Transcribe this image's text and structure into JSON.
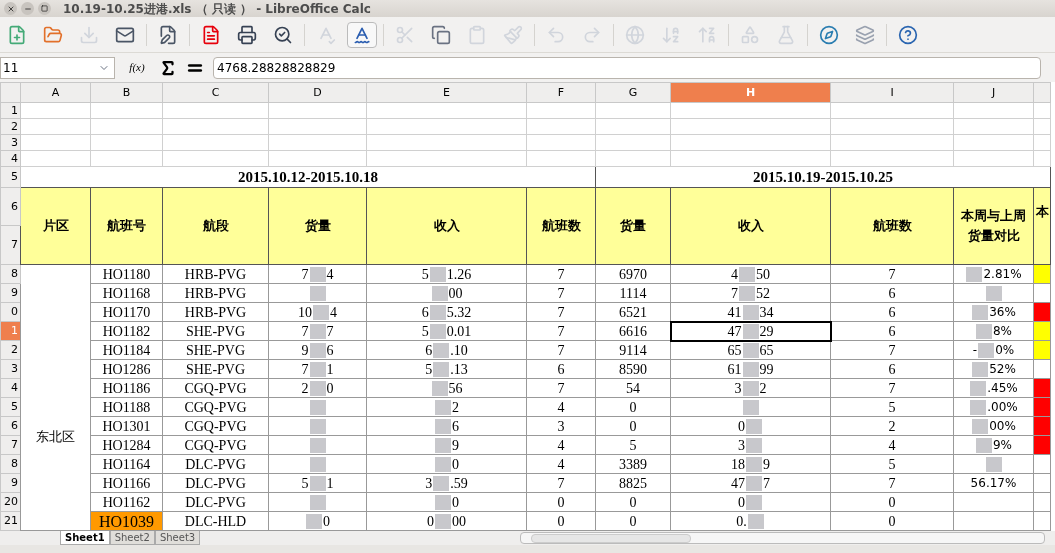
{
  "window": {
    "title": "10.19-10.25进港.xls （ 只读 ） - LibreOffice Calc"
  },
  "formula_bar": {
    "cell_ref": "11",
    "function_label": "f(x)",
    "value": "4768.28828828829"
  },
  "columns": [
    {
      "label": "A",
      "selected": false
    },
    {
      "label": "B",
      "selected": false
    },
    {
      "label": "C",
      "selected": false
    },
    {
      "label": "D",
      "selected": false
    },
    {
      "label": "E",
      "selected": false
    },
    {
      "label": "F",
      "selected": false
    },
    {
      "label": "G",
      "selected": false
    },
    {
      "label": "H",
      "selected": true
    },
    {
      "label": "I",
      "selected": false
    },
    {
      "label": "J",
      "selected": false
    }
  ],
  "blank_rows": [
    "1",
    "2",
    "3",
    "4"
  ],
  "period_row": {
    "num": "5",
    "last_week": "2015.10.12-2015.10.18",
    "this_week": "2015.10.19-2015.10.25"
  },
  "header_rows": [
    "6",
    "7"
  ],
  "headers": [
    "片区",
    "航班号",
    "航段",
    "货量",
    "收入",
    "航班数",
    "货量",
    "收入",
    "航班数",
    "本周与上周货量对比",
    "本"
  ],
  "region": "东北区",
  "rows": [
    {
      "num": "8",
      "selected": false,
      "flight": "HO1180",
      "highlight": false,
      "route": "HRB-PVG",
      "cargo_prev": {
        "smear": true,
        "before": "7",
        "after": "4"
      },
      "revenue_prev": {
        "smear": true,
        "before": "5",
        "after": "1.26"
      },
      "flights_prev": "7",
      "cargo": "6970",
      "revenue": {
        "smear": true,
        "before": "4",
        "after": "50"
      },
      "flights": "7",
      "compare": {
        "smear": true,
        "after": "2.81%"
      },
      "color": "#ffff00"
    },
    {
      "num": "9",
      "selected": false,
      "flight": "HO1168",
      "highlight": false,
      "route": "HRB-PVG",
      "cargo_prev": {
        "smear": true
      },
      "revenue_prev": {
        "smear": true,
        "after": "00"
      },
      "flights_prev": "7",
      "cargo": "1114",
      "revenue": {
        "smear": true,
        "before": "7",
        "after": "52"
      },
      "flights": "6",
      "compare": {
        "smear": true
      },
      "color": "#ffffff"
    },
    {
      "num": "0",
      "selected": false,
      "flight": "HO1170",
      "highlight": false,
      "route": "HRB-PVG",
      "cargo_prev": {
        "smear": true,
        "before": "10",
        "after": "4"
      },
      "revenue_prev": {
        "smear": true,
        "before": "6",
        "after": "5.32"
      },
      "flights_prev": "7",
      "cargo": "6521",
      "revenue": {
        "smear": true,
        "before": "41",
        "after": "34"
      },
      "flights": "6",
      "compare": {
        "smear": true,
        "after": "36%"
      },
      "color": "#ff0000"
    },
    {
      "num": "1",
      "selected": true,
      "flight": "HO1182",
      "highlight": false,
      "route": "SHE-PVG",
      "cargo_prev": {
        "smear": true,
        "before": "7",
        "after": "7"
      },
      "revenue_prev": {
        "smear": true,
        "before": "5",
        "after": "0.01"
      },
      "flights_prev": "7",
      "cargo": "6616",
      "revenue": {
        "smear": true,
        "before": "47",
        "after": "29"
      },
      "flights": "6",
      "compare": {
        "smear": true,
        "after": "8%"
      },
      "color": "#ffff00"
    },
    {
      "num": "2",
      "selected": false,
      "flight": "HO1184",
      "highlight": false,
      "route": "SHE-PVG",
      "cargo_prev": {
        "smear": true,
        "before": "9",
        "after": "6"
      },
      "revenue_prev": {
        "smear": true,
        "before": "6",
        "after": ".10"
      },
      "flights_prev": "7",
      "cargo": "9114",
      "revenue": {
        "smear": true,
        "before": "65",
        "after": "65"
      },
      "flights": "7",
      "compare": {
        "smear": true,
        "before": "-",
        "after": "0%"
      },
      "color": "#ffff00"
    },
    {
      "num": "3",
      "selected": false,
      "flight": "HO1286",
      "highlight": false,
      "route": "SHE-PVG",
      "cargo_prev": {
        "smear": true,
        "before": "7",
        "after": "1"
      },
      "revenue_prev": {
        "smear": true,
        "before": "5",
        "after": ".13"
      },
      "flights_prev": "6",
      "cargo": "8590",
      "revenue": {
        "smear": true,
        "before": "61",
        "after": "99"
      },
      "flights": "6",
      "compare": {
        "smear": true,
        "after": "52%"
      },
      "color": "#ffffff"
    },
    {
      "num": "4",
      "selected": false,
      "flight": "HO1186",
      "highlight": false,
      "route": "CGQ-PVG",
      "cargo_prev": {
        "smear": true,
        "before": "2",
        "after": "0"
      },
      "revenue_prev": {
        "smear": true,
        "after": "56"
      },
      "flights_prev": "7",
      "cargo": "54",
      "revenue": {
        "smear": true,
        "before": "3",
        "after": "2"
      },
      "flights": "7",
      "compare": {
        "smear": true,
        "after": ".45%"
      },
      "color": "#ff0000"
    },
    {
      "num": "5",
      "selected": false,
      "flight": "HO1188",
      "highlight": false,
      "route": "CGQ-PVG",
      "cargo_prev": {
        "smear": true
      },
      "revenue_prev": {
        "smear": true,
        "after": "2"
      },
      "flights_prev": "4",
      "cargo": "0",
      "revenue": {
        "smear": true
      },
      "flights": "5",
      "compare": {
        "smear": true,
        "after": ".00%"
      },
      "color": "#ff0000"
    },
    {
      "num": "6",
      "selected": false,
      "flight": "HO1301",
      "highlight": false,
      "route": "CGQ-PVG",
      "cargo_prev": {
        "smear": true
      },
      "revenue_prev": {
        "smear": true,
        "after": "6"
      },
      "flights_prev": "3",
      "cargo": "0",
      "revenue": {
        "smear": true,
        "before": "0"
      },
      "flights": "2",
      "compare": {
        "smear": true,
        "after": "00%"
      },
      "color": "#ff0000"
    },
    {
      "num": "7",
      "selected": false,
      "flight": "HO1284",
      "highlight": false,
      "route": "CGQ-PVG",
      "cargo_prev": {
        "smear": true
      },
      "revenue_prev": {
        "smear": true,
        "after": "9"
      },
      "flights_prev": "4",
      "cargo": "5",
      "revenue": {
        "smear": true,
        "before": "3"
      },
      "flights": "4",
      "compare": {
        "smear": true,
        "after": "9%"
      },
      "color": "#ff0000"
    },
    {
      "num": "8",
      "selected": false,
      "flight": "HO1164",
      "highlight": false,
      "route": "DLC-PVG",
      "cargo_prev": {
        "smear": true
      },
      "revenue_prev": {
        "smear": true,
        "after": "0"
      },
      "flights_prev": "4",
      "cargo": "3389",
      "revenue": {
        "smear": true,
        "before": "18",
        "after": "9"
      },
      "flights": "5",
      "compare": {
        "smear": true
      },
      "color": "#ffffff"
    },
    {
      "num": "9",
      "selected": false,
      "flight": "HO1166",
      "highlight": false,
      "route": "DLC-PVG",
      "cargo_prev": {
        "smear": true,
        "before": "5",
        "after": "1"
      },
      "revenue_prev": {
        "smear": true,
        "before": "3",
        "after": ".59"
      },
      "flights_prev": "7",
      "cargo": "8825",
      "revenue": {
        "smear": true,
        "before": "47",
        "after": "7"
      },
      "flights": "7",
      "compare": "56.17%",
      "color": "#ffffff"
    },
    {
      "num": "20",
      "selected": false,
      "flight": "HO1162",
      "highlight": false,
      "route": "DLC-PVG",
      "cargo_prev": {
        "smear": true
      },
      "revenue_prev": {
        "smear": true,
        "after": "0"
      },
      "flights_prev": "0",
      "cargo": "0",
      "revenue": {
        "smear": true,
        "before": "0"
      },
      "flights": "0",
      "color": "#ffffff"
    },
    {
      "num": "21",
      "selected": false,
      "flight": "HO1039",
      "highlight": true,
      "route": "DLC-HLD",
      "cargo_prev": {
        "smear": true,
        "after": "0"
      },
      "revenue_prev": {
        "smear": true,
        "before": "0",
        "after": "00"
      },
      "flights_prev": "0",
      "cargo": "0",
      "revenue": {
        "smear": true,
        "before": "0."
      },
      "flights": "0",
      "color": "#ffffff"
    }
  ],
  "sheet_tabs": [
    {
      "label": "Sheet1",
      "selected": true
    },
    {
      "label": "Sheet2",
      "selected": false
    },
    {
      "label": "Sheet3",
      "selected": false
    }
  ]
}
